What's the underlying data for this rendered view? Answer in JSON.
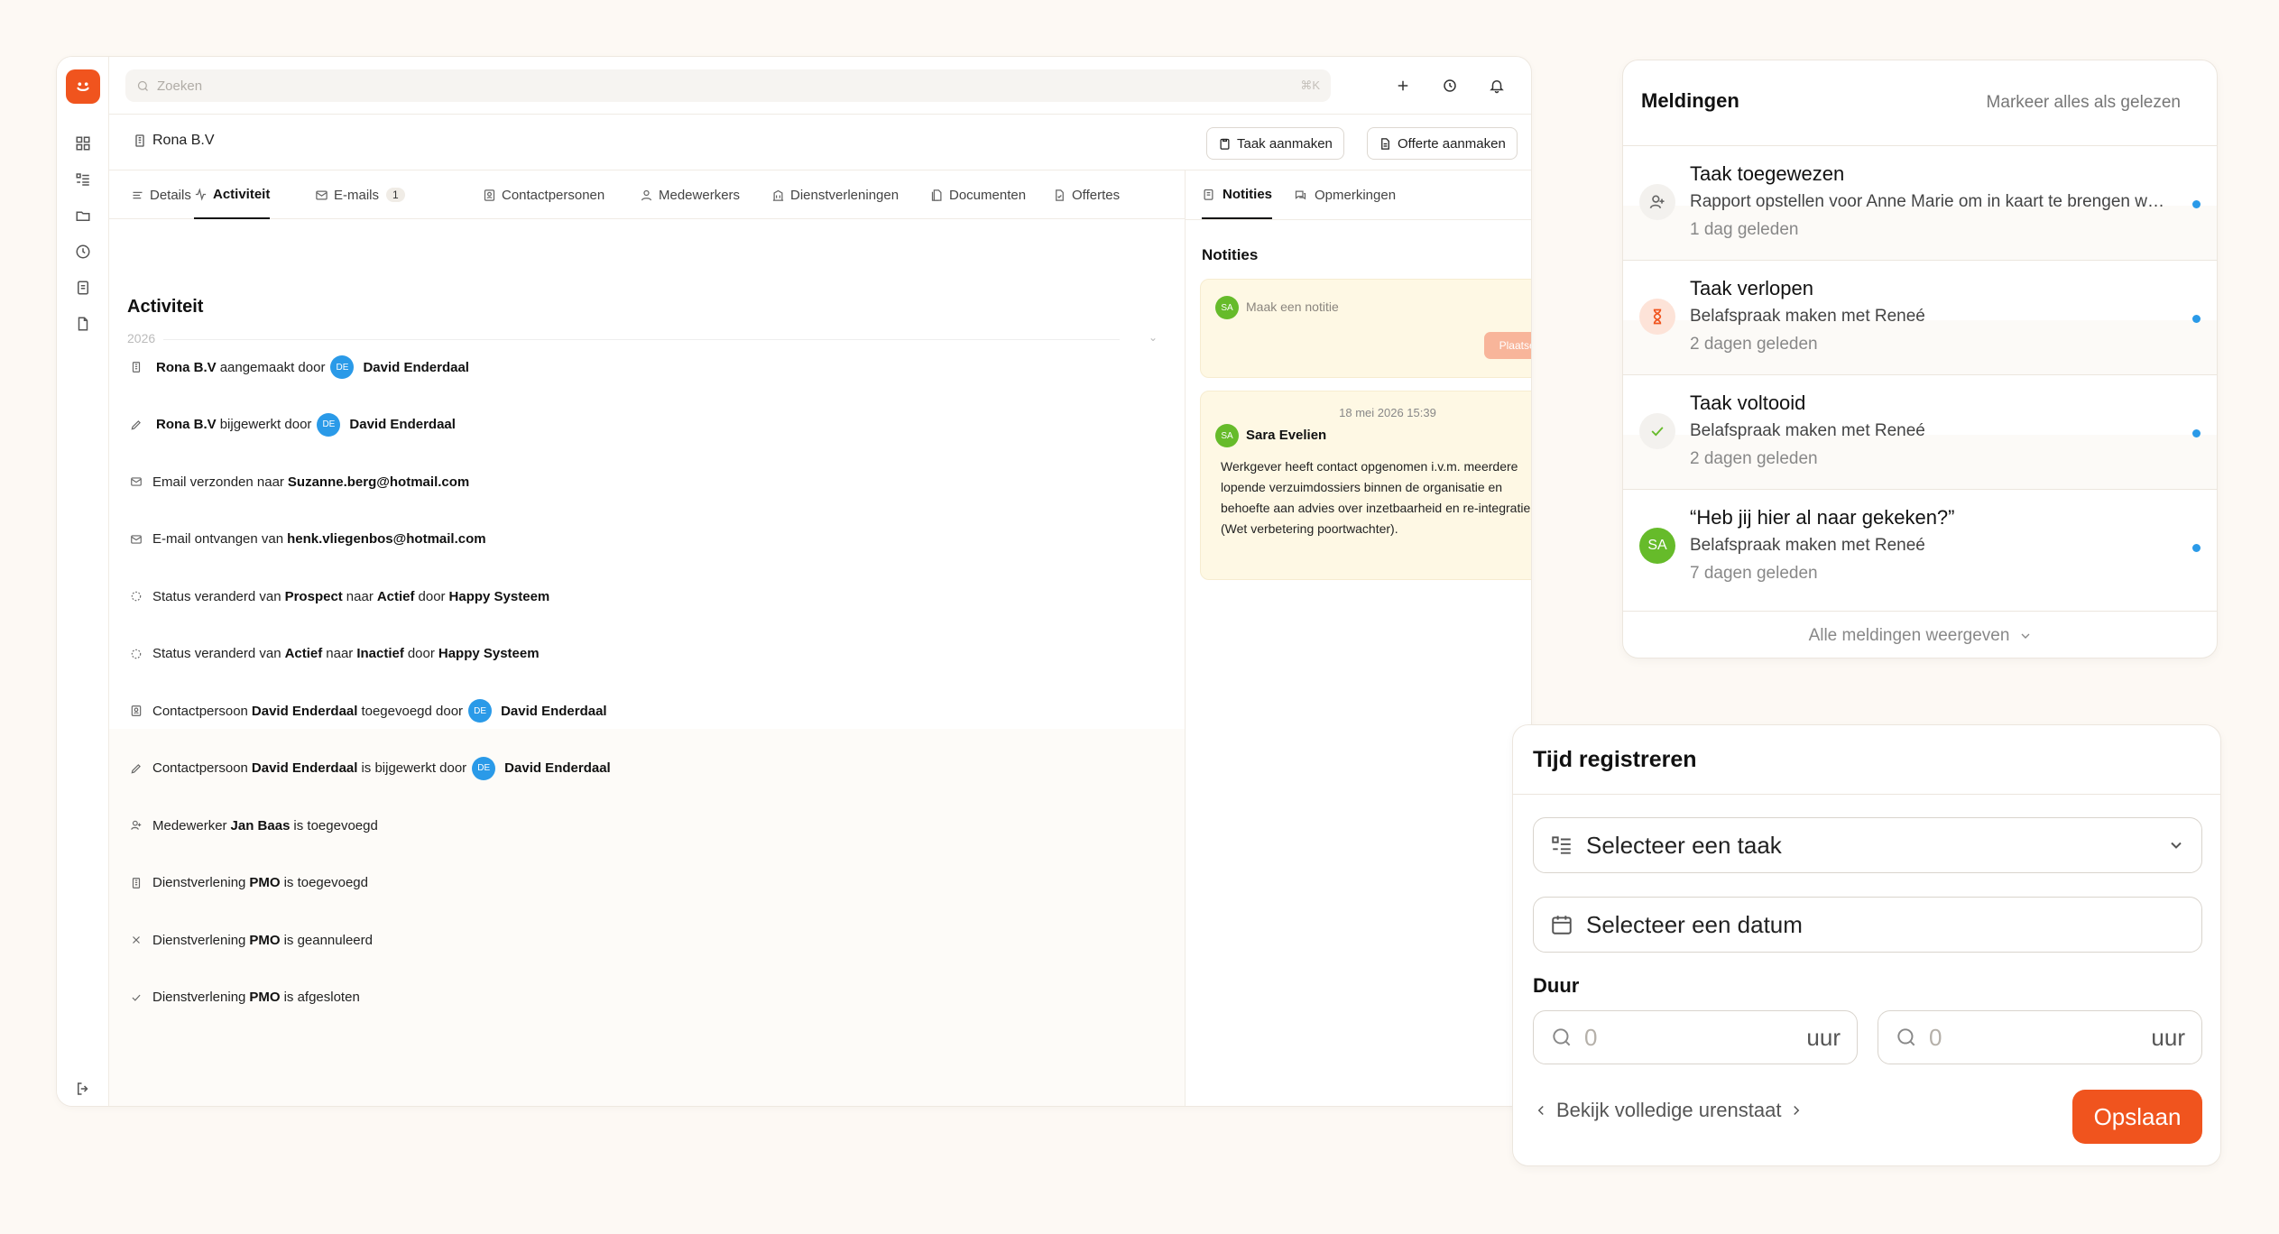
{
  "app": {
    "search": {
      "placeholder": "Zoeken",
      "shortcut": "⌘K"
    },
    "avatar_initials": "SA",
    "company_name": "Rona B.V",
    "actions": {
      "task_button": "Taak aanmaken",
      "quote_button": "Offerte aanmaken",
      "more": "···"
    },
    "tabs": [
      {
        "label": "Details",
        "icon": "list-icon"
      },
      {
        "label": "Activiteit",
        "icon": "activity-icon"
      },
      {
        "label": "E-mails",
        "icon": "mail-icon",
        "count": "1"
      },
      {
        "label": "Contactpersonen",
        "icon": "contact-icon"
      },
      {
        "label": "Medewerkers",
        "icon": "user-icon"
      },
      {
        "label": "Dienstverleningen",
        "icon": "building-icon"
      },
      {
        "label": "Documenten",
        "icon": "document-icon"
      },
      {
        "label": "Offertes",
        "icon": "quote-icon"
      }
    ],
    "activity": {
      "title": "Activiteit",
      "year": "2026",
      "rows": [
        {
          "icon": "building-icon",
          "parts": [
            {
              "b": "Rona B.V"
            },
            {
              "t": "aangemaakt door"
            },
            {
              "av": "DE"
            },
            {
              "b": "David Enderdaal"
            }
          ]
        },
        {
          "icon": "pencil-icon",
          "parts": [
            {
              "b": "Rona B.V"
            },
            {
              "t": "bijgewerkt door"
            },
            {
              "av": "DE"
            },
            {
              "b": "David Enderdaal"
            }
          ]
        },
        {
          "icon": "mail-icon",
          "parts": [
            {
              "t": "Email verzonden naar"
            },
            {
              "b": "Suzanne.berg@hotmail.com"
            }
          ]
        },
        {
          "icon": "mail-icon",
          "parts": [
            {
              "t": "E-mail ontvangen van"
            },
            {
              "b": "henk.vliegenbos@hotmail.com"
            }
          ]
        },
        {
          "icon": "status-icon",
          "parts": [
            {
              "t": "Status veranderd van"
            },
            {
              "b": "Prospect"
            },
            {
              "t": "naar"
            },
            {
              "b": "Actief"
            },
            {
              "t": "door"
            },
            {
              "b": "Happy Systeem"
            }
          ]
        },
        {
          "icon": "status-icon",
          "parts": [
            {
              "t": "Status veranderd van"
            },
            {
              "b": "Actief"
            },
            {
              "t": "naar"
            },
            {
              "b": "Inactief"
            },
            {
              "t": "door"
            },
            {
              "b": "Happy Systeem"
            }
          ]
        },
        {
          "icon": "contact-icon",
          "parts": [
            {
              "t": "Contactpersoon"
            },
            {
              "b": "David Enderdaal"
            },
            {
              "t": "toegevoegd door"
            },
            {
              "av": "DE"
            },
            {
              "b": "David Enderdaal"
            }
          ]
        },
        {
          "icon": "pencil-icon",
          "parts": [
            {
              "t": "Contactpersoon"
            },
            {
              "b": "David Enderdaal"
            },
            {
              "t": "is bijgewerkt door"
            },
            {
              "av": "DE"
            },
            {
              "b": "David Enderdaal"
            }
          ]
        },
        {
          "icon": "user-add-icon",
          "parts": [
            {
              "t": "Medewerker"
            },
            {
              "b": "Jan Baas"
            },
            {
              "t": "is toegevoegd"
            }
          ]
        },
        {
          "icon": "building-icon",
          "parts": [
            {
              "t": "Dienstverlening"
            },
            {
              "b": "PMO"
            },
            {
              "t": "is toegevoegd"
            }
          ]
        },
        {
          "icon": "x-icon",
          "parts": [
            {
              "t": "Dienstverlening"
            },
            {
              "b": "PMO"
            },
            {
              "t": "is geannuleerd"
            }
          ]
        },
        {
          "icon": "check-icon",
          "parts": [
            {
              "t": "Dienstverlening"
            },
            {
              "b": "PMO"
            },
            {
              "t": "is afgesloten"
            }
          ]
        }
      ]
    },
    "notes": {
      "tabs": [
        {
          "label": "Notities",
          "icon": "notes-icon"
        },
        {
          "label": "Opmerkingen",
          "icon": "comments-icon"
        }
      ],
      "heading": "Notities",
      "input_placeholder": "Maak een notitie",
      "post_button": "Plaatsen",
      "note": {
        "date": "18 mei 2026 15:39",
        "author": "Sara Evelien",
        "author_initials": "SA",
        "text": "Werkgever heeft contact opgenomen i.v.m. meerdere lopende verzuimdossiers binnen de organisatie en behoefte aan advies over inzetbaarheid en re-integratie (Wet verbetering poortwachter)."
      }
    }
  },
  "notifications": {
    "title": "Meldingen",
    "mark_all": "Markeer alles als gelezen",
    "items": [
      {
        "icon": "user-add-icon",
        "title": "Taak toegewezen",
        "body": "Rapport opstellen voor Anne Marie om in kaart te brengen welke verzuimdossiers",
        "time": "1 dag geleden"
      },
      {
        "icon": "hourglass-icon",
        "title": "Taak verlopen",
        "body": "Belafspraak maken met Reneé",
        "time": "2 dagen geleden"
      },
      {
        "icon": "check-icon",
        "title": "Taak voltooid",
        "body": "Belafspraak maken met Reneé",
        "time": "2 dagen geleden"
      },
      {
        "icon": "avatar",
        "initials": "SA",
        "title": "“Heb jij hier al naar gekeken?”",
        "body": "Belafspraak maken met Reneé",
        "time": "7 dagen geleden"
      }
    ],
    "footer": "Alle meldingen weergeven",
    "unread_color": "#2a9ae8"
  },
  "time_registration": {
    "title": "Tijd registreren",
    "task_select": "Selecteer een taak",
    "date_select": "Selecteer een datum",
    "duration_label": "Duur",
    "hours_value_1": "0",
    "hours_value_2": "0",
    "unit": "uur",
    "back_link": "Bekijk volledige urenstaat",
    "save_button": "Opslaan"
  },
  "colors": {
    "accent": "#f0541e",
    "avatar_green": "#66bb2a",
    "avatar_blue": "#2a9ae8",
    "note_bg": "#fef8e4"
  }
}
